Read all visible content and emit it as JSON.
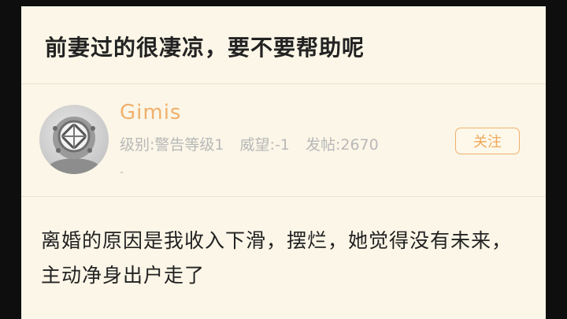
{
  "post": {
    "title": "前妻过的很凄凉，要不要帮助呢",
    "body": "离婚的原因是我收入下滑，摆烂，她觉得没有未来，主动净身出户走了"
  },
  "author": {
    "username": "Gimis",
    "level": "级别:警告等级1",
    "reputation": "威望:-1",
    "posts": "发帖:2670",
    "extra": "-",
    "avatar_icon": "diving-helmet-avatar"
  },
  "actions": {
    "follow_label": "关注"
  },
  "colors": {
    "background": "#fbf6e7",
    "accent": "#f0b06c",
    "meta_text": "#b8b8b8"
  }
}
